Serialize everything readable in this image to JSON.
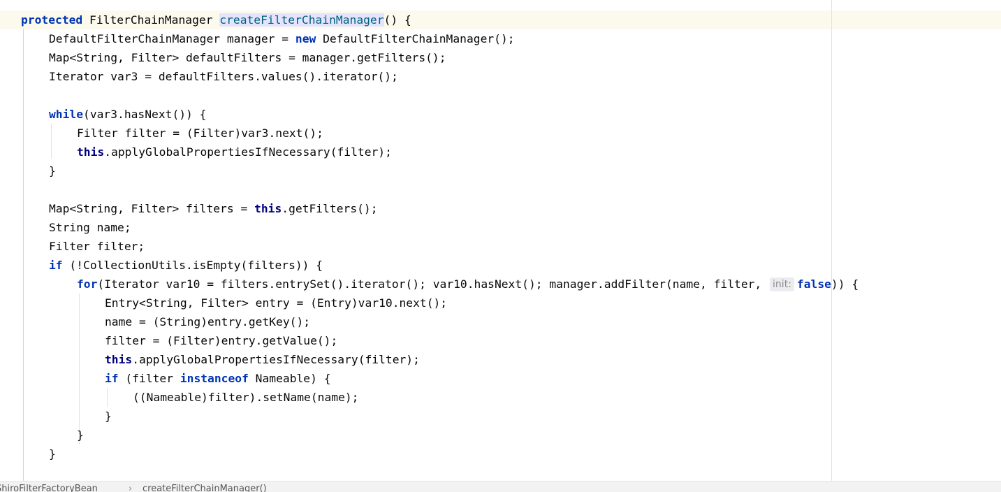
{
  "editor": {
    "lines": [
      {
        "parts": [
          {
            "t": "protected",
            "c": "kw"
          },
          {
            "t": " FilterChainManager "
          },
          {
            "t": "createFilterChainManager",
            "c": "usage-highlight"
          },
          {
            "t": "() {"
          }
        ]
      },
      {
        "parts": [
          {
            "t": "DefaultFilterChainManager manager = "
          },
          {
            "t": "new",
            "c": "kw"
          },
          {
            "t": " DefaultFilterChainManager();"
          }
        ]
      },
      {
        "parts": [
          {
            "t": "Map<String, Filter> defaultFilters = manager.getFilters();"
          }
        ]
      },
      {
        "parts": [
          {
            "t": "Iterator var3 = defaultFilters.values().iterator();"
          }
        ]
      },
      {
        "parts": []
      },
      {
        "parts": [
          {
            "t": "while",
            "c": "kw"
          },
          {
            "t": "(var3.hasNext()) {"
          }
        ]
      },
      {
        "parts": [
          {
            "t": "Filter filter = (Filter)var3.next();"
          }
        ]
      },
      {
        "parts": [
          {
            "t": "this",
            "c": "kw-this"
          },
          {
            "t": ".applyGlobalPropertiesIfNecessary(filter);"
          }
        ]
      },
      {
        "parts": [
          {
            "t": "}"
          }
        ]
      },
      {
        "parts": []
      },
      {
        "parts": [
          {
            "t": "Map<String, Filter> filters = "
          },
          {
            "t": "this",
            "c": "kw-this"
          },
          {
            "t": ".getFilters();"
          }
        ]
      },
      {
        "parts": [
          {
            "t": "String name;"
          }
        ]
      },
      {
        "parts": [
          {
            "t": "Filter filter;"
          }
        ]
      },
      {
        "parts": [
          {
            "t": "if",
            "c": "kw"
          },
          {
            "t": " (!CollectionUtils.isEmpty(filters)) {"
          }
        ]
      },
      {
        "parts": [
          {
            "t": "for",
            "c": "kw"
          },
          {
            "t": "(Iterator var10 = filters.entrySet().iterator(); var10.hasNext(); manager.addFilter(name, filter, "
          },
          {
            "t": "init:",
            "c": "inlay-hint"
          },
          {
            "t": "false",
            "c": "kw"
          },
          {
            "t": ")) {"
          }
        ]
      },
      {
        "parts": [
          {
            "t": "Entry<String, Filter> entry = (Entry)var10.next();"
          }
        ]
      },
      {
        "parts": [
          {
            "t": "name = (String)entry.getKey();"
          }
        ]
      },
      {
        "parts": [
          {
            "t": "filter = (Filter)entry.getValue();"
          }
        ]
      },
      {
        "parts": [
          {
            "t": "this",
            "c": "kw-this"
          },
          {
            "t": ".applyGlobalPropertiesIfNecessary(filter);"
          }
        ]
      },
      {
        "parts": [
          {
            "t": "if",
            "c": "kw"
          },
          {
            "t": " (filter "
          },
          {
            "t": "instanceof",
            "c": "kw"
          },
          {
            "t": " Nameable) {"
          }
        ]
      },
      {
        "parts": [
          {
            "t": "((Nameable)filter).setName(name);"
          }
        ]
      },
      {
        "parts": [
          {
            "t": "}"
          }
        ]
      },
      {
        "parts": [
          {
            "t": "}"
          }
        ]
      },
      {
        "parts": [
          {
            "t": "}"
          }
        ]
      }
    ]
  },
  "breadcrumb": {
    "class_name": "ShiroFilterFactoryBean",
    "separator": "›",
    "method_name": "createFilterChainManager()"
  }
}
